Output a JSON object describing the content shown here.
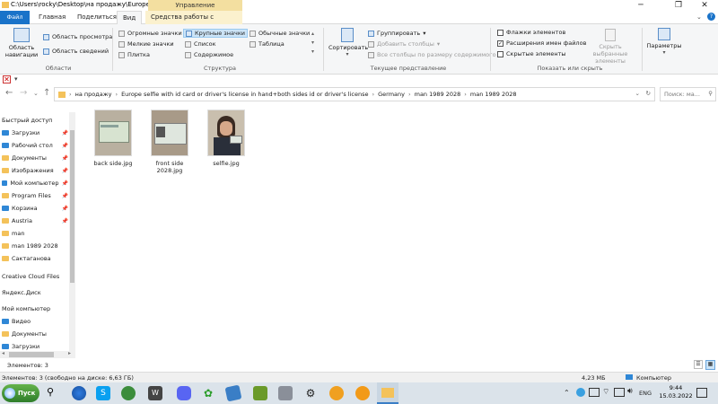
{
  "window": {
    "title": "C:\\Users\\rocky\\Desktop\\на продажу\\Europe...",
    "context_tab_header": "Управление"
  },
  "tabs": [
    "Файл",
    "Главная",
    "Поделиться",
    "Вид",
    "Средства работы с рисунками"
  ],
  "ribbon": {
    "panels": {
      "nav_pane": "Область навигации",
      "preview": "Область просмотра",
      "details": "Область сведений",
      "label": "Области"
    },
    "layout": {
      "items": [
        "Огромные значки",
        "Крупные значки",
        "Обычные значки",
        "Мелкие значки",
        "Список",
        "Таблица",
        "Плитка",
        "Содержимое"
      ],
      "label": "Структура"
    },
    "current_view": {
      "sort": "Сортировать",
      "group": "Группировать",
      "add_cols": "Добавить столбцы",
      "size_cols": "Все столбцы по размеру содержимого",
      "label": "Текущее представление"
    },
    "show_hide": {
      "item_checkboxes": "Флажки элементов",
      "extensions": "Расширения имен файлов",
      "hidden": "Скрытые элементы",
      "hide_selected": "Скрыть выбранные элементы",
      "label": "Показать или скрыть"
    },
    "options": "Параметры"
  },
  "address": {
    "crumbs": [
      "на продажу",
      "Europe selfie with id card or driver's license in hand+both sides id or driver's license",
      "Germany",
      "man 1989 2028",
      "man 1989 2028"
    ],
    "search_placeholder": "Поиск: ма..."
  },
  "sidebar": {
    "quick_access": "Быстрый доступ",
    "items": [
      "Загрузки",
      "Рабочий стол",
      "Документы",
      "Изображения",
      "Мой компьютер",
      "Program Files",
      "Корзина",
      "Austria",
      "man",
      "man 1989 2028",
      "Сактаганова"
    ],
    "creative_cloud": "Creative Cloud Files",
    "yandex": "Яндекс.Диск",
    "my_computer": "Мой компьютер",
    "computer_items": [
      "Видео",
      "Документы",
      "Загрузки"
    ]
  },
  "files": [
    {
      "name": "back side.jpg"
    },
    {
      "name": "front side 2028.jpg"
    },
    {
      "name": "selfie.jpg"
    }
  ],
  "status": {
    "items_count": "Элементов: 3",
    "bottom_left": "Элементов: 3 (свободно на диске: 6,63 ГБ)",
    "size": "4,23 МБ",
    "location": "Компьютер"
  },
  "taskbar": {
    "start": "Пуск",
    "lang": "ENG",
    "time": "9:44",
    "date": "15.03.2022"
  }
}
